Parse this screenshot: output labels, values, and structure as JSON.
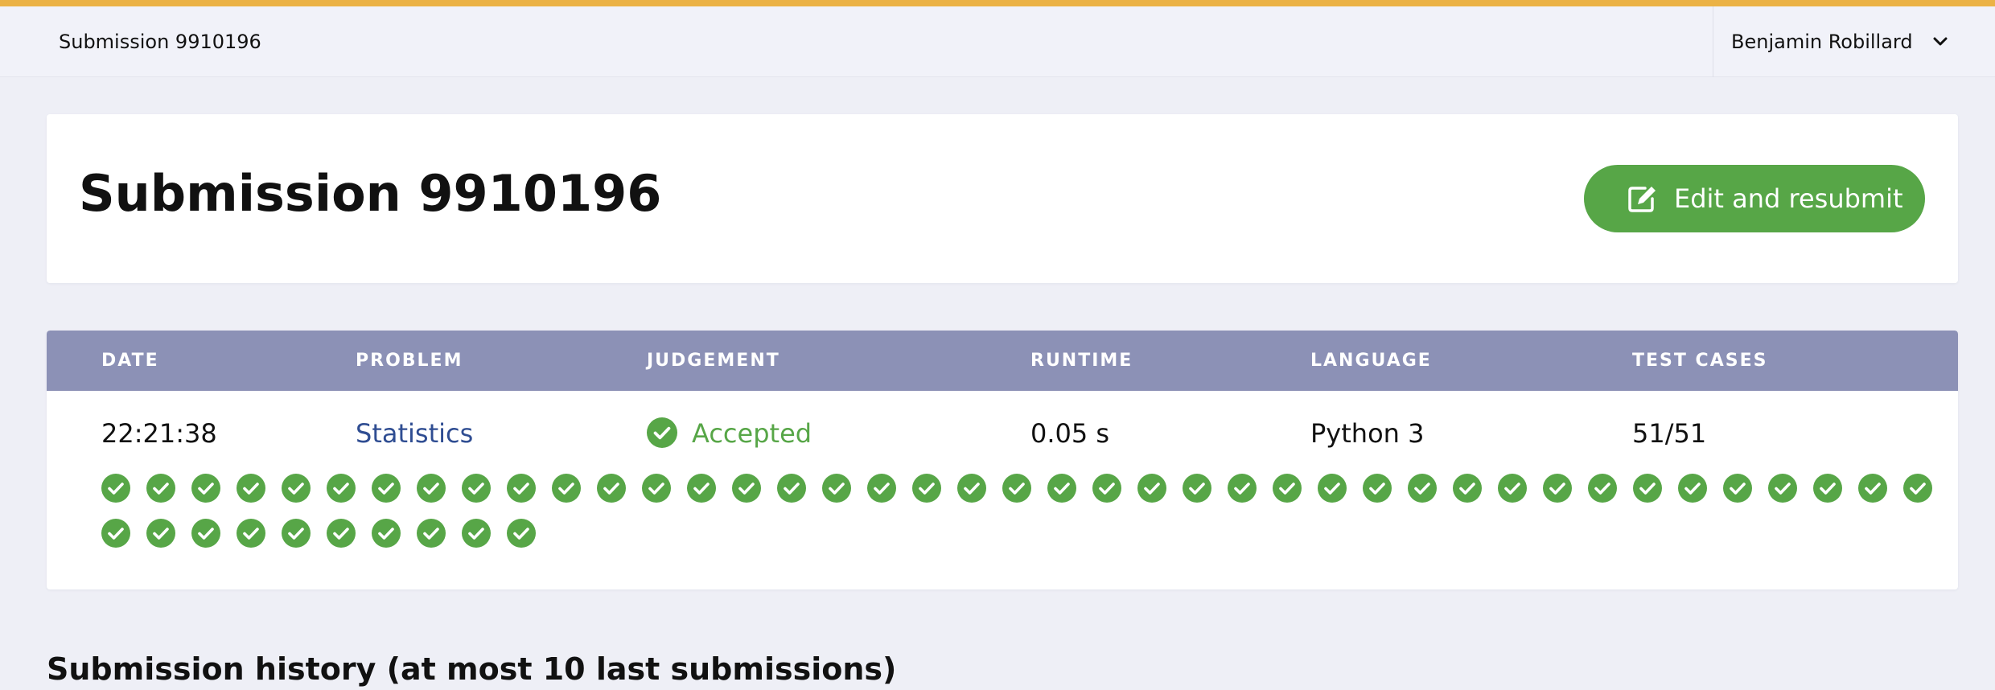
{
  "topbar": {
    "title": "Submission 9910196",
    "user_name": "Benjamin Robillard",
    "user_menu_icon": "chevron-down-icon"
  },
  "header": {
    "title": "Submission 9910196",
    "edit_button": {
      "label": "Edit and resubmit",
      "icon": "edit-icon"
    }
  },
  "table": {
    "columns": [
      "DATE",
      "PROBLEM",
      "JUDGEMENT",
      "RUNTIME",
      "LANGUAGE",
      "TEST CASES"
    ],
    "row": {
      "date": "22:21:38",
      "problem": "Statistics",
      "judgement": "Accepted",
      "runtime": "0.05 s",
      "language": "Python 3",
      "test_cases": "51/51"
    },
    "test_case_results": {
      "passed": 51,
      "total": 51,
      "icon": "check-circle-icon"
    }
  },
  "history": {
    "title": "Submission history (at most 10 last submissions)"
  },
  "colors": {
    "accent": "#ebb245",
    "success": "#57a647",
    "table_header": "#8c91b6",
    "link": "#2f4d92"
  }
}
